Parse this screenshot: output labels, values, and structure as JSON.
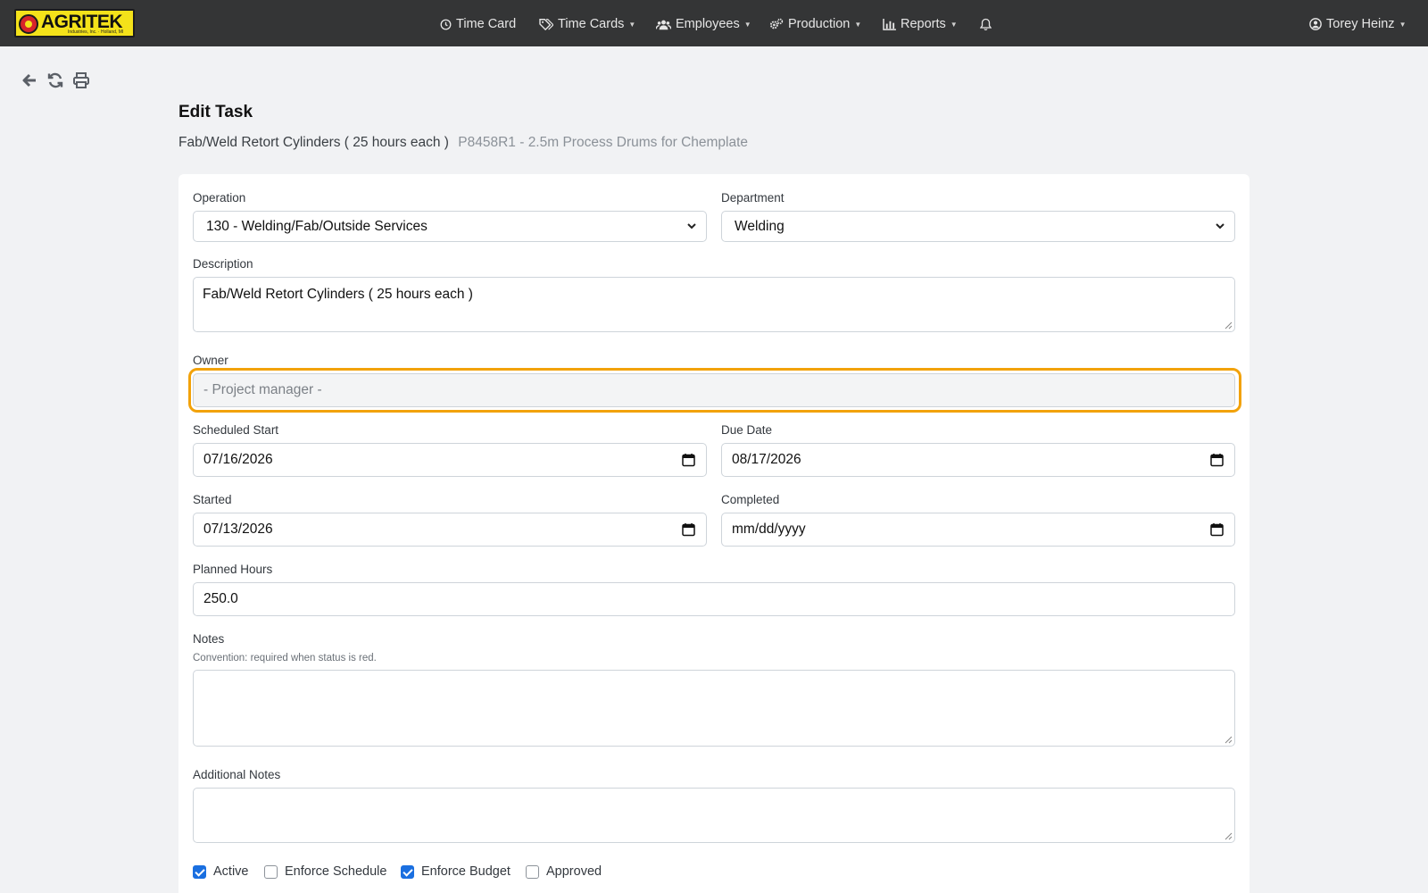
{
  "brand": {
    "name": "AGRITEK",
    "tagline": "Industries, Inc. · Holland, MI"
  },
  "nav": {
    "time_card": "Time Card",
    "time_cards": "Time Cards",
    "employees": "Employees",
    "production": "Production",
    "reports": "Reports",
    "user": "Torey Heinz"
  },
  "toolbar": {
    "icons": [
      "back-arrow-icon",
      "refresh-icon",
      "print-icon"
    ]
  },
  "page": {
    "title": "Edit Task",
    "task_name": "Fab/Weld Retort Cylinders ( 25 hours each )",
    "project": "P8458R1 - 2.5m Process Drums for Chemplate"
  },
  "form": {
    "operation": {
      "label": "Operation",
      "value": "130 - Welding/Fab/Outside Services"
    },
    "department": {
      "label": "Department",
      "value": "Welding"
    },
    "description": {
      "label": "Description",
      "value": "Fab/Weld Retort Cylinders ( 25 hours each )"
    },
    "owner": {
      "label": "Owner",
      "placeholder": "- Project manager -"
    },
    "scheduled_start": {
      "label": "Scheduled Start",
      "value": "07/16/2026"
    },
    "due_date": {
      "label": "Due Date",
      "value": "08/17/2026"
    },
    "started": {
      "label": "Started",
      "value": "07/13/2026"
    },
    "completed": {
      "label": "Completed",
      "value": "mm/dd/yyyy"
    },
    "planned_hours": {
      "label": "Planned Hours",
      "value": "250.0"
    },
    "notes": {
      "label": "Notes",
      "help": "Convention: required when status is red.",
      "value": ""
    },
    "additional_notes": {
      "label": "Additional Notes",
      "value": ""
    },
    "checkboxes": {
      "active": {
        "label": "Active",
        "checked": true
      },
      "enforce_schedule": {
        "label": "Enforce Schedule",
        "checked": false
      },
      "enforce_budget": {
        "label": "Enforce Budget",
        "checked": true
      },
      "approved": {
        "label": "Approved",
        "checked": false
      }
    }
  },
  "colors": {
    "navbar": "#343536",
    "focus": "#f2a20a",
    "checkbox": "#1a6fe0",
    "logo": "#f4e21a"
  }
}
